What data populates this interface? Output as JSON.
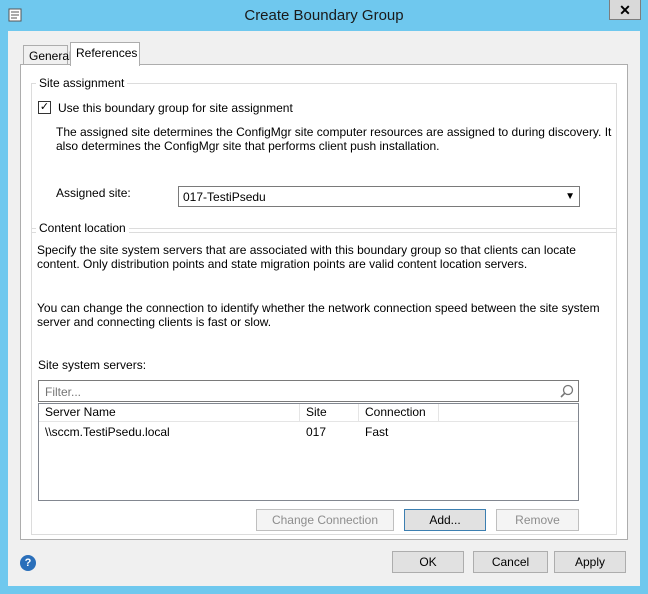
{
  "window": {
    "title": "Create Boundary Group",
    "close_glyph": "✕"
  },
  "tabs": [
    {
      "label": "General",
      "active": false
    },
    {
      "label": "References",
      "active": true
    }
  ],
  "site_assignment": {
    "legend": "Site assignment",
    "checkbox_label": "Use this boundary group for site assignment",
    "checked": true,
    "description": "The assigned site determines the ConfigMgr site computer resources are assigned to during discovery. It also determines the ConfigMgr site that performs client push installation.",
    "assigned_site_label": "Assigned site:",
    "assigned_site_value": "017-TestiPsedu"
  },
  "content_location": {
    "legend": "Content location",
    "description1": "Specify the site system servers that are associated with this boundary group so that clients can locate content. Only distribution points and state migration points are valid content location servers.",
    "description2": "You can change the connection to identify whether the network connection speed between the site system server and connecting clients is fast or slow.",
    "servers_label": "Site system servers:",
    "filter_placeholder": "Filter...",
    "columns": [
      "Server Name",
      "Site",
      "Connection"
    ],
    "rows": [
      {
        "server": "\\\\sccm.TestiPsedu.local",
        "site": "017",
        "connection": "Fast"
      }
    ],
    "buttons": {
      "change_connection": "Change Connection",
      "add": "Add...",
      "remove": "Remove"
    }
  },
  "footer": {
    "ok": "OK",
    "cancel": "Cancel",
    "apply": "Apply",
    "help_glyph": "?"
  },
  "icons": {
    "app": "dialog-icon",
    "search": "search-icon",
    "help": "help-icon",
    "dropdown": "chevron-down-icon"
  }
}
